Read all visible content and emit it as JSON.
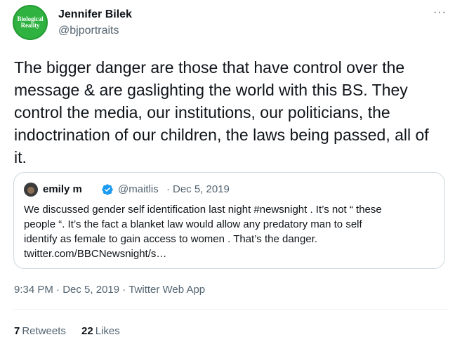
{
  "author": {
    "name": "Jennifer Bilek",
    "handle": "@bjportraits",
    "avatar_text": "Biological\nReality",
    "avatar_color": "#2fb23f"
  },
  "more_icon": "···",
  "tweet_text": "The bigger danger are those that have control over the message & are gaslighting the world with this BS. They control the media, our institutions, our politicians, the indoctrination of our children, the laws being passed, all of it.",
  "quoted": {
    "name": "emily m",
    "verified_icon": "verified-badge-icon",
    "handle": "@maitlis",
    "separator": "·",
    "date": "Dec 5, 2019",
    "lines": [
      "We discussed gender self identification last night #newsnight . It’s not “ these",
      "people “. It’s the fact a blanket law would allow any predatory man to self",
      "identify as female to gain access to women . That’s the danger.",
      "twitter.com/BBCNewsnight/s…"
    ]
  },
  "meta": {
    "time": "9:34 PM",
    "sep1": "·",
    "date": "Dec 5, 2019",
    "sep2": "·",
    "source": "Twitter Web App"
  },
  "stats": {
    "retweets_count": "7",
    "retweets_label": "Retweets",
    "likes_count": "22",
    "likes_label": "Likes"
  },
  "colors": {
    "text": "#0f1419",
    "secondary": "#536471",
    "verified": "#1d9bf0",
    "border": "#cfd9de"
  }
}
